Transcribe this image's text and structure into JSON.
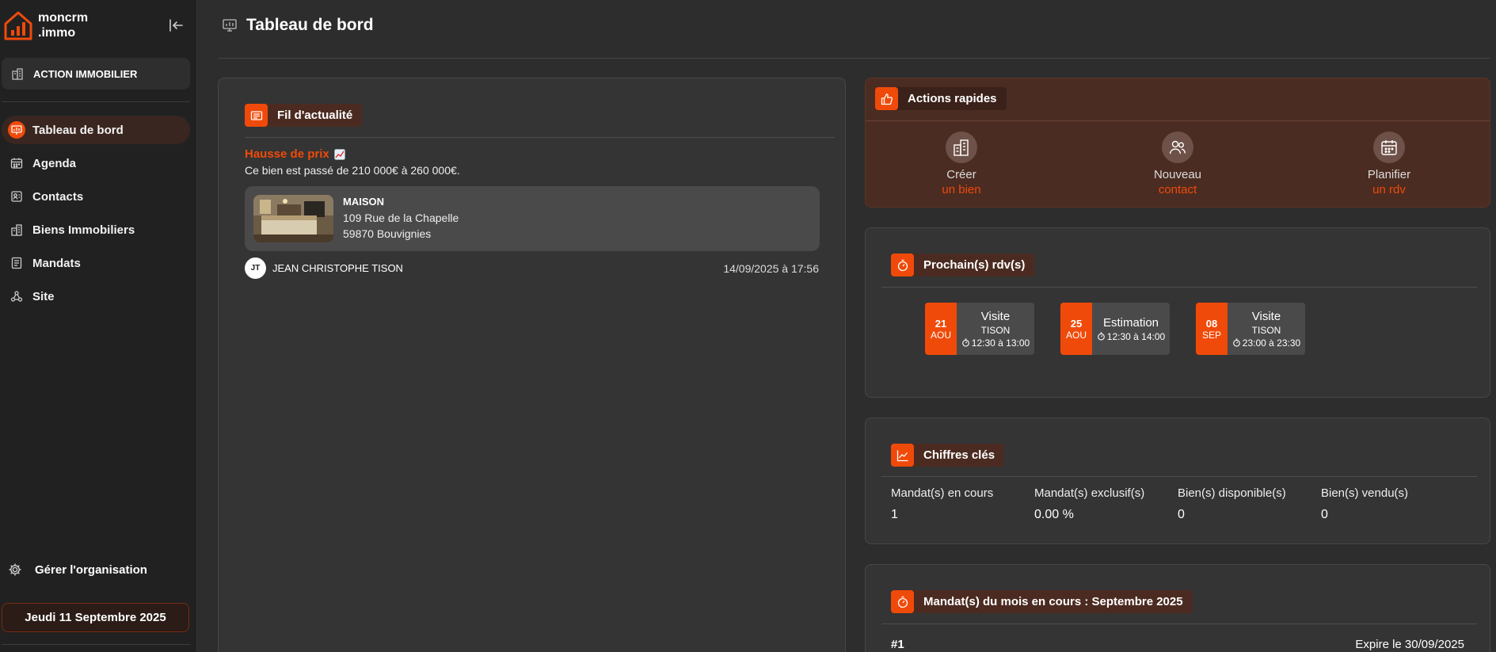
{
  "brand": {
    "line1": "moncrm",
    "line2": ".immo",
    "accent": "#f04a0a"
  },
  "sidebar": {
    "org": "ACTION IMMOBILIER",
    "items": [
      {
        "label": "Tableau de bord",
        "icon": "dashboard-icon",
        "active": true
      },
      {
        "label": "Agenda",
        "icon": "calendar-icon"
      },
      {
        "label": "Contacts",
        "icon": "contacts-icon"
      },
      {
        "label": "Biens Immobiliers",
        "icon": "building-icon"
      },
      {
        "label": "Mandats",
        "icon": "document-icon"
      },
      {
        "label": "Site",
        "icon": "webhook-icon"
      }
    ],
    "settings": "Gérer l'organisation",
    "date": "Jeudi 11 Septembre 2025"
  },
  "header": {
    "title": "Tableau de bord"
  },
  "feed": {
    "title": "Fil d'actualité",
    "event_title": "Hausse de prix",
    "event_text": "Ce bien est passé de 210 000€ à 260 000€.",
    "property": {
      "type": "MAISON",
      "address1": "109 Rue de la Chapelle",
      "address2": "59870 Bouvignies"
    },
    "author_initials": "JT",
    "author": "JEAN CHRISTOPHE TISON",
    "date": "14/09/2025 à 17:56"
  },
  "actions": {
    "title": "Actions rapides",
    "items": [
      {
        "line1": "Créer",
        "line2": "un bien",
        "icon": "building-icon"
      },
      {
        "line1": "Nouveau",
        "line2": "contact",
        "icon": "users-icon"
      },
      {
        "line1": "Planifier",
        "line2": "un rdv",
        "icon": "calendar-icon"
      }
    ]
  },
  "rdv": {
    "title": "Prochain(s) rdv(s)",
    "items": [
      {
        "day": "21",
        "month": "AOU",
        "type": "Visite",
        "name": "TISON",
        "hours": "12:30 à 13:00"
      },
      {
        "day": "25",
        "month": "AOU",
        "type": "Estimation",
        "name": "",
        "hours": "12:30 à 14:00"
      },
      {
        "day": "08",
        "month": "SEP",
        "type": "Visite",
        "name": "TISON",
        "hours": "23:00 à 23:30"
      }
    ]
  },
  "kpis": {
    "title": "Chiffres clés",
    "items": [
      {
        "label": "Mandat(s) en cours",
        "value": "1"
      },
      {
        "label": "Mandat(s) exclusif(s)",
        "value": "0.00 %"
      },
      {
        "label": "Bien(s) disponible(s)",
        "value": "0"
      },
      {
        "label": "Bien(s) vendu(s)",
        "value": "0"
      }
    ]
  },
  "mandats": {
    "title": "Mandat(s) du mois en cours : Septembre 2025",
    "number": "#1",
    "expires": "Expire le 30/09/2025"
  }
}
